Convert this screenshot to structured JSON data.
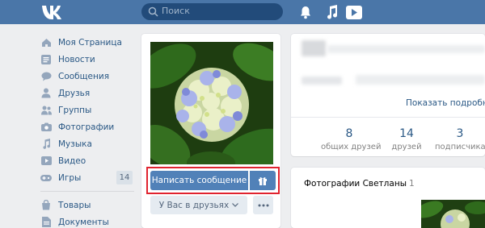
{
  "topbar": {
    "search_placeholder": "Поиск",
    "icons": [
      "vk-logo-icon",
      "search-icon",
      "bell-icon",
      "music-icon",
      "video-icon"
    ]
  },
  "menu": {
    "items": [
      {
        "label": "Моя Страница",
        "icon": "home-icon"
      },
      {
        "label": "Новости",
        "icon": "news-icon"
      },
      {
        "label": "Сообщения",
        "icon": "messages-icon"
      },
      {
        "label": "Друзья",
        "icon": "friends-icon"
      },
      {
        "label": "Группы",
        "icon": "groups-icon"
      },
      {
        "label": "Фотографии",
        "icon": "photo-icon"
      },
      {
        "label": "Музыка",
        "icon": "music-icon"
      },
      {
        "label": "Видео",
        "icon": "video-icon"
      },
      {
        "label": "Игры",
        "icon": "games-icon",
        "badge": "14"
      }
    ],
    "extra_items": [
      {
        "label": "Товары",
        "icon": "goods-icon"
      },
      {
        "label": "Документы",
        "icon": "documents-icon"
      }
    ]
  },
  "profile": {
    "write_message_label": "Написать сообщение",
    "friend_status_label": "У Вас в друзьях",
    "show_more_label": "Показать подробную",
    "stats": [
      {
        "value": "8",
        "label": "общих друзей"
      },
      {
        "value": "14",
        "label": "друзей"
      },
      {
        "value": "3",
        "label": "подписчика"
      }
    ],
    "photos_title": "Фотографии Светланы",
    "photos_count": "1"
  },
  "colors": {
    "header": "#4a76a8",
    "accent": "#5181b8",
    "link": "#2a5885",
    "highlight": "#e0232f",
    "background": "#edeef0"
  }
}
